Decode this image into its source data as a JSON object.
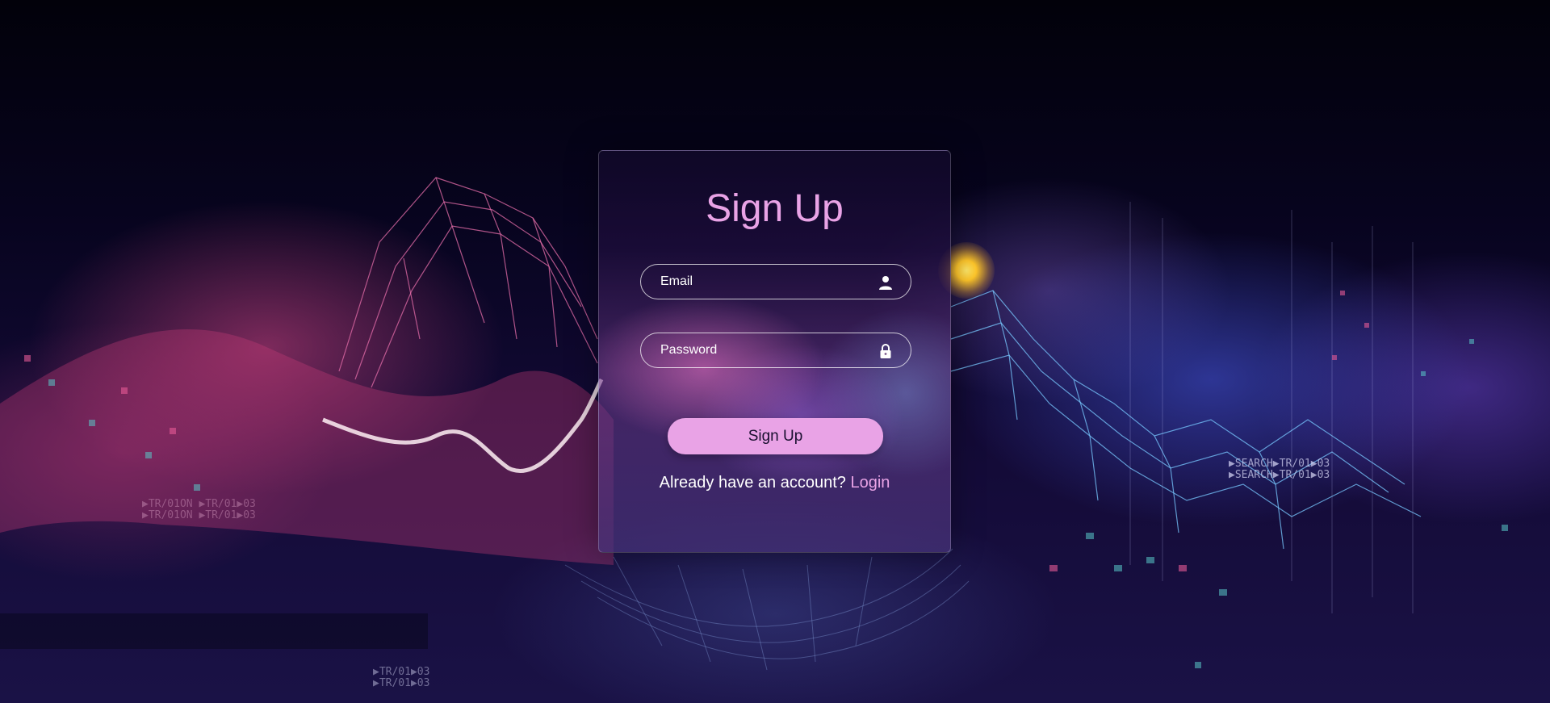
{
  "form": {
    "title": "Sign Up",
    "email": {
      "placeholder": "Email",
      "value": ""
    },
    "password": {
      "placeholder": "Password",
      "value": ""
    },
    "submit_label": "Sign Up",
    "footer_text": "Already have an account?",
    "login_link": "Login"
  },
  "background_text": {
    "left": "▶TR/01ON ▶TR/01▶03\n▶TR/01ON ▶TR/01▶03",
    "right": "▶SEARCH▶TR/01▶03\n▶SEARCH▶TR/01▶03",
    "bottom": "▶TR/01▶03\n▶TR/01▶03"
  },
  "icons": {
    "email": "user-icon",
    "password": "lock-icon"
  },
  "colors": {
    "accent": "#e9a3e6",
    "text": "#ffffff",
    "button_text": "#1a1030"
  }
}
